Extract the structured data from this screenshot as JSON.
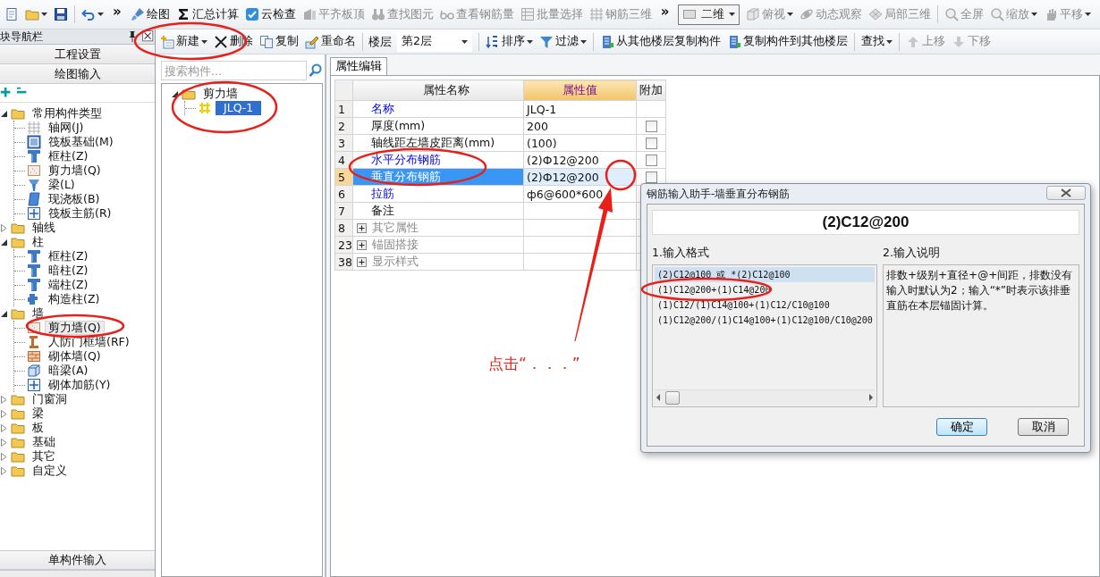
{
  "toolbar": {
    "items": [
      {
        "kind": "icon",
        "disabled": false,
        "dropdown": false
      },
      {
        "kind": "icon",
        "disabled": false,
        "dropdown": true
      },
      {
        "kind": "icon",
        "disabled": false,
        "dropdown": false
      },
      {
        "kind": "sep"
      },
      {
        "kind": "icon",
        "disabled": false,
        "dropdown": true
      },
      {
        "kind": "chevron",
        "label": "»"
      },
      {
        "kind": "button",
        "label": "绘图",
        "disabled": false,
        "dropdown": false
      },
      {
        "kind": "button",
        "label": "汇总计算",
        "disabled": false,
        "dropdown": false
      },
      {
        "kind": "button",
        "label": "云检查",
        "disabled": false,
        "dropdown": false
      },
      {
        "kind": "button",
        "label": "平齐板顶",
        "disabled": true,
        "dropdown": false
      },
      {
        "kind": "button",
        "label": "查找图元",
        "disabled": true,
        "dropdown": false
      },
      {
        "kind": "button",
        "label": "查看钢筋量",
        "disabled": true,
        "dropdown": false
      },
      {
        "kind": "button",
        "label": "批量选择",
        "disabled": true,
        "dropdown": false
      },
      {
        "kind": "button",
        "label": "钢筋三维",
        "disabled": true,
        "dropdown": false
      },
      {
        "kind": "chevron",
        "label": "»"
      },
      {
        "kind": "combo",
        "label": "二维",
        "disabled": false,
        "dropdown": true
      },
      {
        "kind": "button",
        "label": "俯视",
        "disabled": true,
        "dropdown": true
      },
      {
        "kind": "button",
        "label": "动态观察",
        "disabled": true,
        "dropdown": false
      },
      {
        "kind": "button",
        "label": "局部三维",
        "disabled": true,
        "dropdown": false
      },
      {
        "kind": "sep"
      },
      {
        "kind": "button",
        "label": "全屏",
        "disabled": true,
        "dropdown": false
      },
      {
        "kind": "button",
        "label": "缩放",
        "disabled": true,
        "dropdown": true
      },
      {
        "kind": "button",
        "label": "平移",
        "disabled": true,
        "dropdown": true
      }
    ]
  },
  "nav": {
    "title": "块导航栏",
    "buttons": [
      "工程设置",
      "绘图输入"
    ],
    "tree": [
      {
        "kind": "folder",
        "label": "常用构件类型",
        "expanded": true,
        "selected": false,
        "children": [
          {
            "kind": "component",
            "label": "轴网(J)",
            "selected": false
          },
          {
            "kind": "component",
            "label": "筏板基础(M)",
            "selected": false
          },
          {
            "kind": "component",
            "label": "框柱(Z)",
            "selected": false
          },
          {
            "kind": "component",
            "label": "剪力墙(Q)",
            "selected": false
          },
          {
            "kind": "component",
            "label": "梁(L)",
            "selected": false
          },
          {
            "kind": "component",
            "label": "现浇板(B)",
            "selected": false
          },
          {
            "kind": "component",
            "label": "筏板主筋(R)",
            "selected": false
          }
        ]
      },
      {
        "kind": "folder",
        "label": "轴线",
        "expanded": false,
        "selected": false
      },
      {
        "kind": "folder",
        "label": "柱",
        "expanded": true,
        "selected": false,
        "children": [
          {
            "kind": "component",
            "label": "框柱(Z)",
            "selected": false
          },
          {
            "kind": "component",
            "label": "暗柱(Z)",
            "selected": false
          },
          {
            "kind": "component",
            "label": "端柱(Z)",
            "selected": false
          },
          {
            "kind": "component",
            "label": "构造柱(Z)",
            "selected": false
          }
        ]
      },
      {
        "kind": "folder",
        "label": "墙",
        "expanded": true,
        "selected": false,
        "children": [
          {
            "kind": "component",
            "label": "剪力墙(Q)",
            "selected": true
          },
          {
            "kind": "component",
            "label": "人防门框墙(RF)",
            "selected": false
          },
          {
            "kind": "component",
            "label": "砌体墙(Q)",
            "selected": false
          },
          {
            "kind": "component",
            "label": "暗梁(A)",
            "selected": false
          },
          {
            "kind": "component",
            "label": "砌体加筋(Y)",
            "selected": false
          }
        ]
      },
      {
        "kind": "folder",
        "label": "门窗洞",
        "expanded": false,
        "selected": false
      },
      {
        "kind": "folder",
        "label": "梁",
        "expanded": false,
        "selected": false
      },
      {
        "kind": "folder",
        "label": "板",
        "expanded": false,
        "selected": false
      },
      {
        "kind": "folder",
        "label": "基础",
        "expanded": false,
        "selected": false
      },
      {
        "kind": "folder",
        "label": "其它",
        "expanded": false,
        "selected": false
      },
      {
        "kind": "folder",
        "label": "自定义",
        "expanded": false,
        "selected": false
      }
    ],
    "bottom_buttons": [
      "单构件输入"
    ]
  },
  "component_toolbar": {
    "items": [
      {
        "kind": "button",
        "label": "新建",
        "disabled": false,
        "dropdown": true
      },
      {
        "kind": "button",
        "label": "删除",
        "disabled": false,
        "dropdown": false
      },
      {
        "kind": "button",
        "label": "复制",
        "disabled": false,
        "dropdown": false
      },
      {
        "kind": "button",
        "label": "重命名",
        "disabled": false,
        "dropdown": false
      },
      {
        "kind": "sep"
      },
      {
        "kind": "label",
        "label": "楼层"
      },
      {
        "kind": "combo",
        "label": "第2层",
        "disabled": false,
        "dropdown": true
      },
      {
        "kind": "sep"
      },
      {
        "kind": "button",
        "label": "排序",
        "disabled": false,
        "dropdown": true
      },
      {
        "kind": "button",
        "label": "过滤",
        "disabled": false,
        "dropdown": true
      },
      {
        "kind": "sep"
      },
      {
        "kind": "button",
        "label": "从其他楼层复制构件",
        "disabled": false,
        "dropdown": false
      },
      {
        "kind": "button",
        "label": "复制构件到其他楼层",
        "disabled": false,
        "dropdown": false
      },
      {
        "kind": "sep"
      },
      {
        "kind": "button",
        "label": "查找",
        "disabled": false,
        "dropdown": true
      },
      {
        "kind": "sep"
      },
      {
        "kind": "button",
        "label": "上移",
        "disabled": true,
        "dropdown": false
      },
      {
        "kind": "button",
        "label": "下移",
        "disabled": true,
        "dropdown": false
      }
    ]
  },
  "component_list": {
    "search": {
      "placeholder": "搜索构件..."
    },
    "tree": [
      {
        "kind": "folder",
        "label": "剪力墙",
        "expanded": true,
        "selected": false,
        "children": [
          {
            "kind": "component",
            "label": "JLQ-1",
            "selected": true
          }
        ]
      }
    ]
  },
  "properties": {
    "tabs": [
      {
        "label": "属性编辑",
        "selected": true
      }
    ],
    "columns": [
      "属性名称",
      "属性值",
      "附加"
    ],
    "rows": [
      {
        "number": "1",
        "name": "名称",
        "value": "JLQ-1",
        "kind": "public",
        "selected": false
      },
      {
        "number": "2",
        "name": "厚度(mm)",
        "value": "200",
        "kind": "private",
        "selected": false,
        "checked": false
      },
      {
        "number": "3",
        "name": "轴线距左墙皮距离(mm)",
        "value": "(100)",
        "kind": "private",
        "selected": false,
        "checked": false
      },
      {
        "number": "4",
        "name": "水平分布钢筋",
        "value": "(2)Ф12@200",
        "kind": "public",
        "selected": false,
        "checked": false
      },
      {
        "number": "5",
        "name": "垂直分布钢筋",
        "value": "(2)Ф12@200",
        "kind": "public",
        "selected": true,
        "checked": false
      },
      {
        "number": "6",
        "name": "拉筋",
        "value": "ф6@600*600",
        "kind": "public",
        "selected": false
      },
      {
        "number": "7",
        "name": "备注",
        "kind": "private",
        "selected": false
      },
      {
        "number": "8",
        "name": "其它属性",
        "kind": "group",
        "expanded": false,
        "selected": false
      },
      {
        "number": "23",
        "name": "锚固搭接",
        "kind": "group",
        "expanded": false,
        "selected": false
      },
      {
        "number": "38",
        "name": "显示样式",
        "kind": "group",
        "expanded": false,
        "selected": false
      }
    ]
  },
  "dialog": {
    "title": "钢筋输入助手-墙垂直分布钢筋",
    "value": "(2)C12@200",
    "format_label": "1.输入格式",
    "help_label": "2.输入说明",
    "formats": [
      {
        "text": "(2)C12@100 或 *(2)C12@100",
        "selected": true
      },
      {
        "text": "(1)C12@200+(1)C14@200",
        "selected": false
      },
      {
        "text": "(1)C12/(1)C14@100+(1)C12/C10@100",
        "selected": false
      },
      {
        "text": "(1)C12@200/(1)C14@100+(1)C12@100/C10@200",
        "selected": false
      }
    ],
    "help": "排数+级别+直径+@+间距，排数没有输入时默认为2；输入“*”时表示该排垂直筋在本层锚固计算。",
    "buttons": [
      {
        "label": "确定",
        "default": true
      },
      {
        "label": "取消",
        "default": false
      }
    ]
  },
  "annotation": {
    "text": "点击“．．．”"
  }
}
